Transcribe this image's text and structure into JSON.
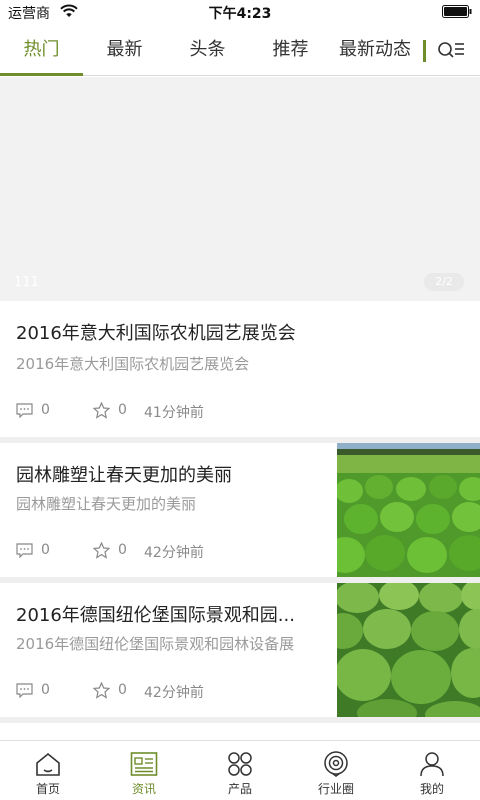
{
  "status_bar": {
    "carrier": "运营商",
    "time": "下午4:23"
  },
  "tabs": [
    {
      "label": "热门"
    },
    {
      "label": "最新"
    },
    {
      "label": "头条"
    },
    {
      "label": "推荐"
    },
    {
      "label": "最新动态"
    }
  ],
  "active_tab": "热门",
  "banner": {
    "caption": "111",
    "pager": "2/2"
  },
  "articles": [
    {
      "title": "2016年意大利国际农机园艺展览会",
      "summary": "2016年意大利国际农机园艺展览会",
      "comments": "0",
      "stars": "0",
      "time": "41分钟前"
    },
    {
      "title": "园林雕塑让春天更加的美丽",
      "summary": "园林雕塑让春天更加的美丽",
      "comments": "0",
      "stars": "0",
      "time": "42分钟前"
    },
    {
      "title": "2016年德国纽伦堡国际景观和园...",
      "summary": "2016年德国纽伦堡国际景观和园林设备展",
      "comments": "0",
      "stars": "0",
      "time": "42分钟前"
    }
  ],
  "bottom_nav": [
    {
      "label": "首页",
      "icon": "home-icon"
    },
    {
      "label": "资讯",
      "icon": "news-icon"
    },
    {
      "label": "产品",
      "icon": "products-icon"
    },
    {
      "label": "行业圈",
      "icon": "industry-circle-icon"
    },
    {
      "label": "我的",
      "icon": "profile-icon"
    }
  ],
  "active_nav": "资讯",
  "colors": {
    "accent": "#6e8e2b",
    "text": "#222222",
    "muted": "#9a9a9a",
    "divider": "#efefef"
  }
}
